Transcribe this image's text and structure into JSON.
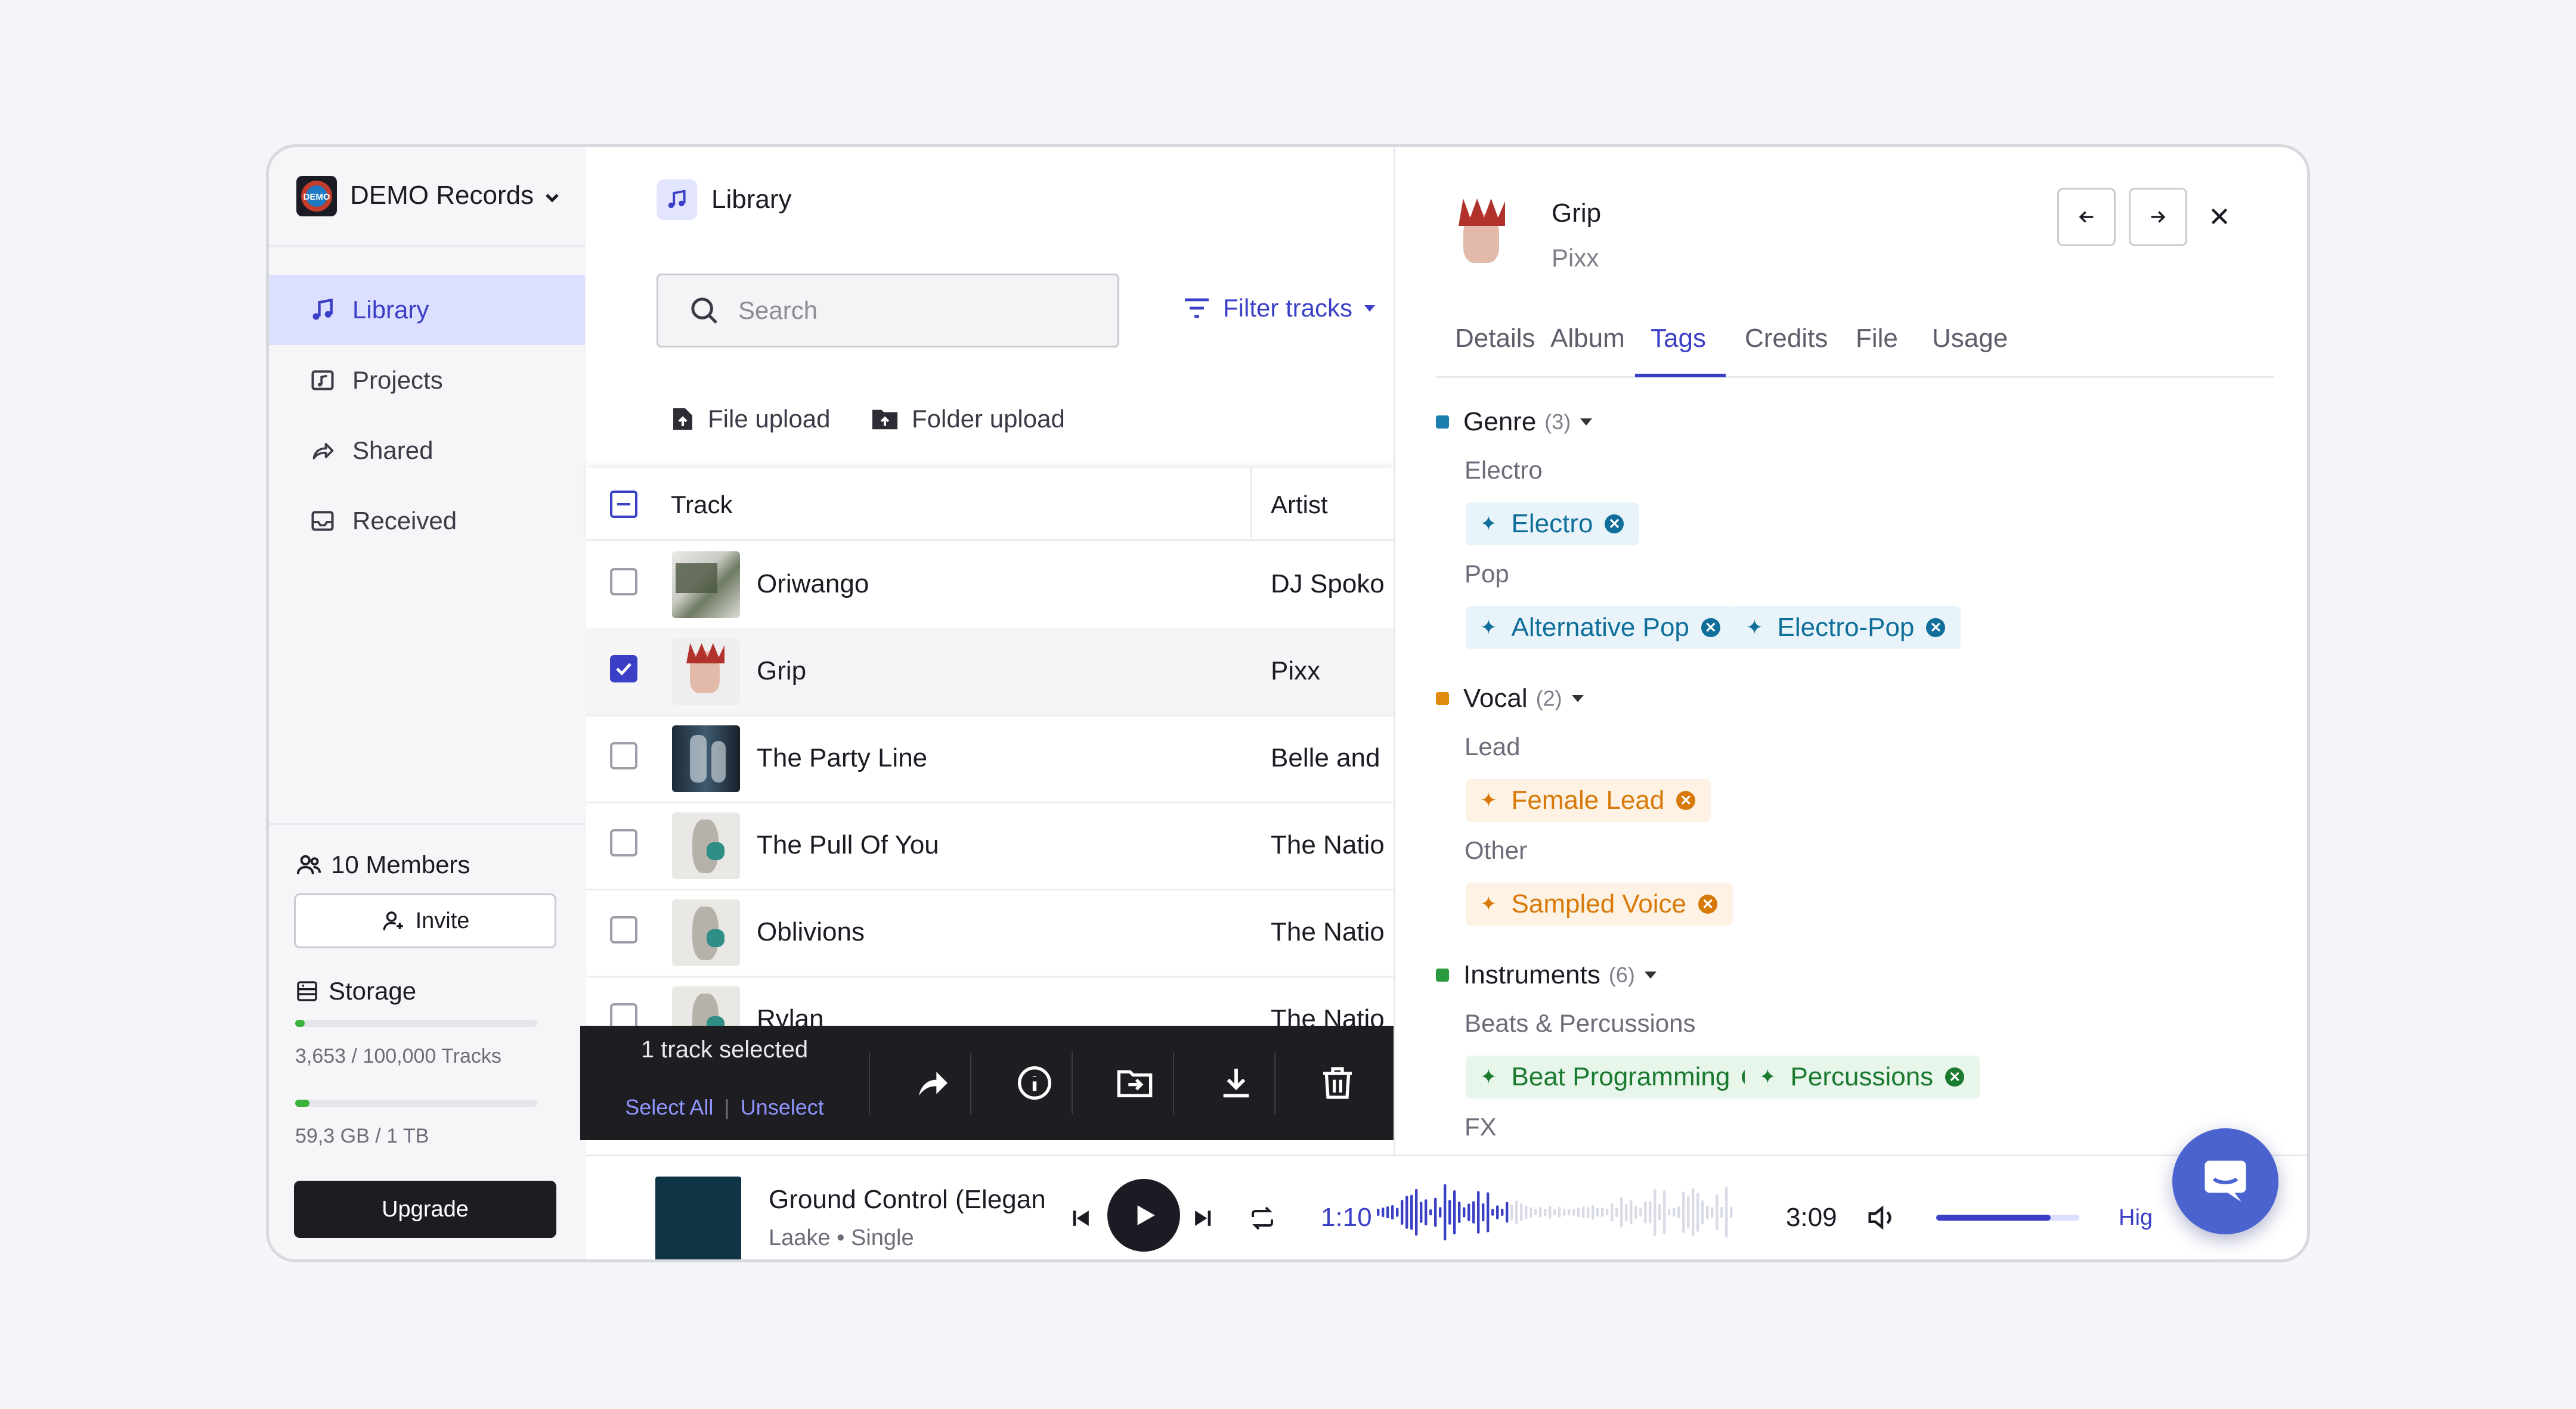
{
  "org": {
    "name": "DEMO Records",
    "logo_text": "DEMO"
  },
  "nav": [
    {
      "label": "Library",
      "icon": "music-note-icon",
      "active": true
    },
    {
      "label": "Projects",
      "icon": "folder-music-icon"
    },
    {
      "label": "Shared",
      "icon": "share-arrow-icon"
    },
    {
      "label": "Received",
      "icon": "inbox-icon"
    }
  ],
  "members": {
    "label": "10 Members",
    "invite_label": "Invite"
  },
  "storage": {
    "title": "Storage",
    "tracks_text": "3,653 / 100,000 Tracks",
    "tracks_fraction": 0.037,
    "space_text": "59,3 GB / 1 TB",
    "space_fraction": 0.059,
    "upgrade_label": "Upgrade"
  },
  "main": {
    "title": "Library",
    "search_placeholder": "Search",
    "filter_label": "Filter tracks",
    "file_upload": "File upload",
    "folder_upload": "Folder upload",
    "columns": {
      "track": "Track",
      "artist": "Artist"
    }
  },
  "tracks": [
    {
      "name": "Oriwango",
      "artist": "DJ Spoko",
      "checked": false
    },
    {
      "name": "Grip",
      "artist": "Pixx",
      "checked": true
    },
    {
      "name": "The Party Line",
      "artist": "Belle and",
      "checked": false
    },
    {
      "name": "The Pull Of You",
      "artist": "The Natio",
      "checked": false
    },
    {
      "name": "Oblivions",
      "artist": "The Natio",
      "checked": false
    },
    {
      "name": "Rylan",
      "artist": "The Natio",
      "checked": false
    }
  ],
  "selection_bar": {
    "count_text": "1 track selected",
    "select_all": "Select All",
    "separator": "|",
    "unselect": "Unselect"
  },
  "detail": {
    "title": "Grip",
    "artist": "Pixx",
    "tabs": [
      "Details",
      "Album",
      "Tags",
      "Credits",
      "File",
      "Usage"
    ],
    "active_tab": "Tags",
    "colors": {
      "genre": "#1a7fae",
      "vocal": "#e08a12",
      "instruments": "#2a9a3f"
    },
    "groups": {
      "genre": {
        "name": "Genre",
        "count": "(3)",
        "sub1": "Electro",
        "tag1": "Electro",
        "sub2": "Pop",
        "tag2": "Alternative Pop",
        "tag3": "Electro-Pop"
      },
      "vocal": {
        "name": "Vocal",
        "count": "(2)",
        "sub1": "Lead",
        "tag1": "Female Lead",
        "sub2": "Other",
        "tag2": "Sampled Voice"
      },
      "instruments": {
        "name": "Instruments",
        "count": "(6)",
        "sub1": "Beats & Percussions",
        "tag1": "Beat Programming",
        "tag2": "Percussions",
        "sub2": "FX"
      }
    }
  },
  "player": {
    "title": "Ground Control (Elegan",
    "subtitle": "Laake • Single",
    "elapsed": "1:10",
    "duration": "3:09",
    "progress_fraction": 0.37,
    "volume_fraction": 0.8,
    "quality": "Hig"
  }
}
